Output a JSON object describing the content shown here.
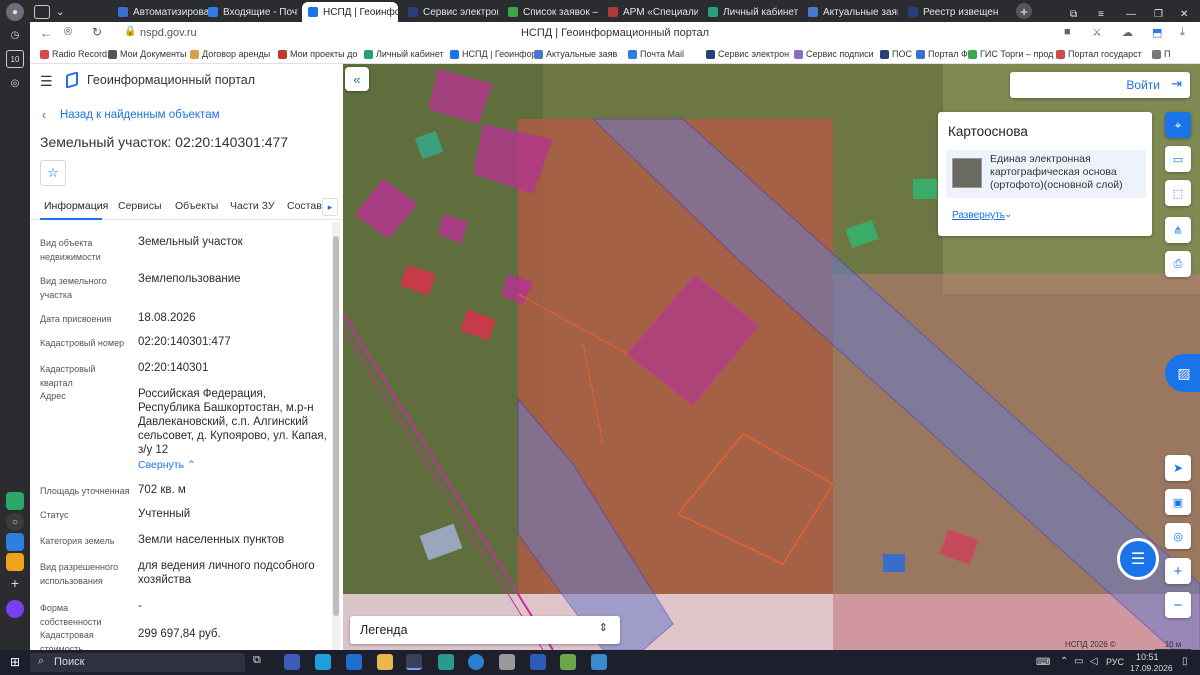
{
  "browser": {
    "tabs": [
      {
        "label": "Автоматизирован",
        "color": "#3a6fd8"
      },
      {
        "label": "Входящие - Почта",
        "color": "#2f7fe0"
      },
      {
        "label": "НСПД | Геоинфо",
        "color": "#1a73e8"
      },
      {
        "label": "Сервис электронн",
        "color": "#2a3f7a"
      },
      {
        "label": "Список заявок — Т",
        "color": "#3ca64a"
      },
      {
        "label": "АРМ «Специалист»",
        "color": "#b03a3a"
      },
      {
        "label": "Личный кабинет",
        "color": "#2aa07a"
      },
      {
        "label": "Актуальные заявле",
        "color": "#4a78c8"
      },
      {
        "label": "Реестр извещений",
        "color": "#2a3f7a"
      }
    ],
    "url": "nspd.gov.ru",
    "page_title": "НСПД | Геоинформационный портал",
    "bookmarks": [
      "Radio Record",
      "Мои Документы",
      "Договор аренды",
      "Мои проекты до",
      "Личный кабинет",
      "НСПД | Геоинфор",
      "Актуальные заяв",
      "Почта Mail",
      "Сервис электрон",
      "Сервис подписи",
      "ПОС",
      "Портал ФК",
      "ГИС Торги – прод",
      "Портал государст",
      "П"
    ]
  },
  "portal": {
    "title": "Геоинформационный портал",
    "back_link": "Назад к найденным объектам",
    "object_title": "Земельный участок: 02:20:140301:477",
    "tabs": [
      "Информация",
      "Сервисы",
      "Объекты",
      "Части ЗУ",
      "Состав"
    ],
    "fields": [
      {
        "label": "Вид объекта недвижимости",
        "value": "Земельный участок"
      },
      {
        "label": "Вид земельного участка",
        "value": "Землепользование"
      },
      {
        "label": "Дата присвоения",
        "value": "18.08.2026"
      },
      {
        "label": "Кадастровый номер",
        "value": "02:20:140301:477"
      },
      {
        "label": "Кадастровый квартал",
        "value": "02:20:140301"
      },
      {
        "label": "Адрес",
        "value": "Российская Федерация, Республика Башкортостан, м.р-н Давлекановский, с.п. Алгинский сельсовет, д. Купоярово, ул. Капая, з/у 12"
      },
      {
        "label": "Площадь уточненная",
        "value": "702 кв. м"
      },
      {
        "label": "Статус",
        "value": "Учтенный"
      },
      {
        "label": "Категория земель",
        "value": "Земли населенных пунктов"
      },
      {
        "label": "Вид разрешенного использования",
        "value": "для ведения личного подсобного хозяйства"
      },
      {
        "label": "Форма собственности",
        "value": "-"
      },
      {
        "label": "Кадастровая стоимость",
        "value": "299 697,84 руб."
      }
    ],
    "collapse_link": "Свернуть"
  },
  "map": {
    "login": "Войти",
    "basemap_title": "Картооснова",
    "basemap_layer": "Единая электронная картографическая основа (ортофото)(основной слой)",
    "expand_link": "Развернуть",
    "legend": "Легенда",
    "copyright": "НСПД 2026 ©",
    "scale": "10 м"
  },
  "taskbar": {
    "search": "Поиск",
    "lang": "РУС",
    "time": "10:51",
    "date": "17.09.2026"
  },
  "colors": {
    "accent": "#1a73e8",
    "parcel_fill": "#c0504a",
    "parcel_pink": "#c72da6",
    "road": "#6a7dc8"
  }
}
